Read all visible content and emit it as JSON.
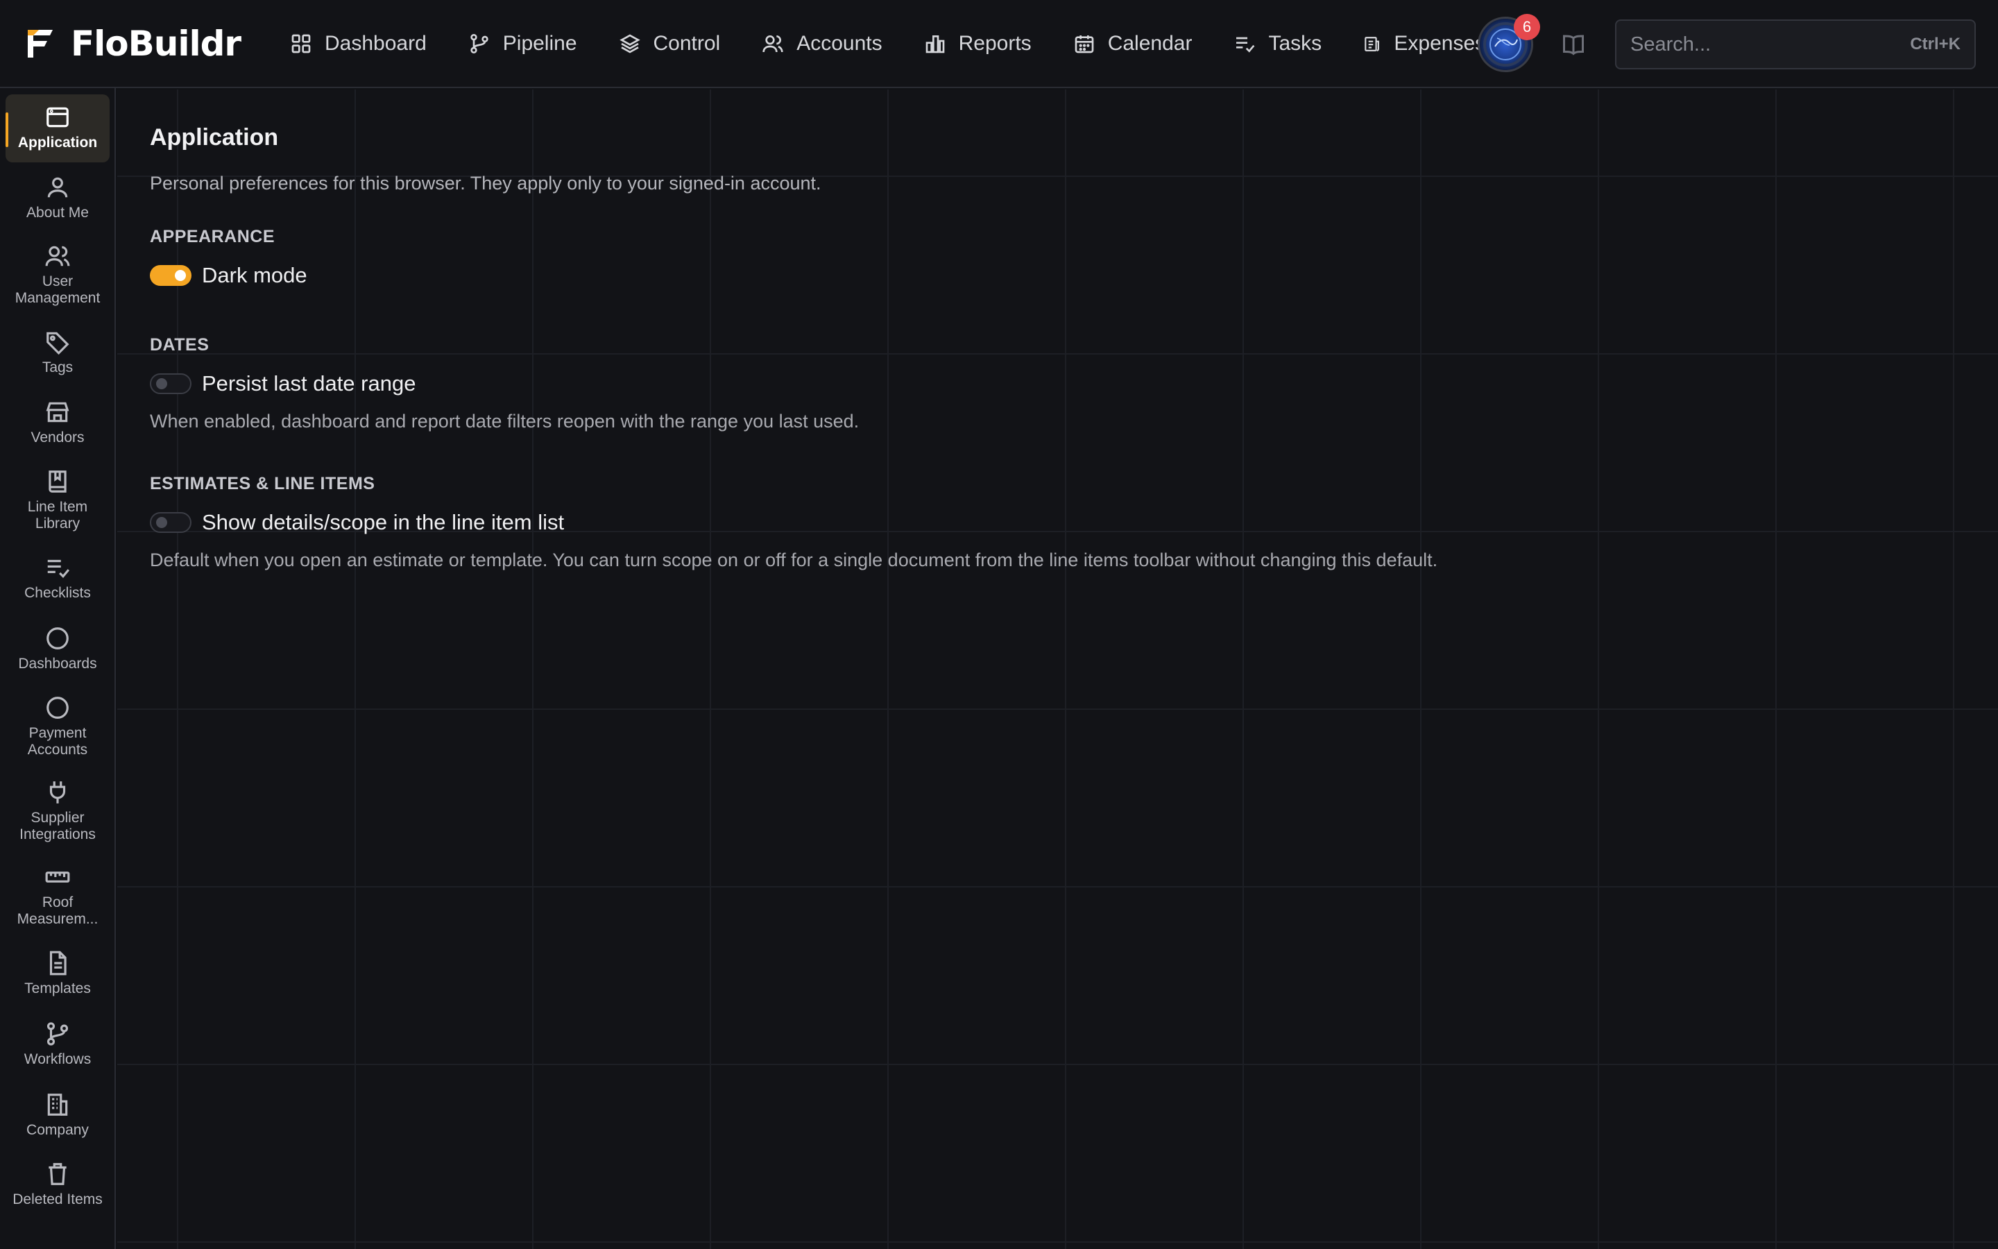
{
  "brand": {
    "name": "FloBuildr"
  },
  "nav": [
    {
      "label": "Dashboard",
      "icon": "grid-icon"
    },
    {
      "label": "Pipeline",
      "icon": "git-branch-icon"
    },
    {
      "label": "Control",
      "icon": "layers-icon"
    },
    {
      "label": "Accounts",
      "icon": "users-icon"
    },
    {
      "label": "Reports",
      "icon": "bar-chart-icon"
    },
    {
      "label": "Calendar",
      "icon": "calendar-icon"
    },
    {
      "label": "Tasks",
      "icon": "checklist-icon"
    },
    {
      "label": "Expenses",
      "icon": "receipt-icon"
    }
  ],
  "notifications": {
    "count": "6"
  },
  "search": {
    "placeholder": "Search...",
    "shortcut": "Ctrl+K"
  },
  "sidebar": {
    "items": [
      {
        "label": "Application",
        "icon": "window-icon",
        "active": true
      },
      {
        "label": "About Me",
        "icon": "user-icon"
      },
      {
        "label": "User Management",
        "icon": "users-icon"
      },
      {
        "label": "Tags",
        "icon": "tag-icon"
      },
      {
        "label": "Vendors",
        "icon": "store-icon"
      },
      {
        "label": "Line Item Library",
        "icon": "book-icon"
      },
      {
        "label": "Checklists",
        "icon": "checklist-icon"
      },
      {
        "label": "Dashboards",
        "icon": "circle-icon"
      },
      {
        "label": "Payment Accounts",
        "icon": "circle-icon"
      },
      {
        "label": "Supplier Integrations",
        "icon": "plug-icon"
      },
      {
        "label": "Roof Measurem...",
        "icon": "ruler-icon"
      },
      {
        "label": "Templates",
        "icon": "file-icon"
      },
      {
        "label": "Workflows",
        "icon": "git-branch-icon"
      },
      {
        "label": "Company",
        "icon": "building-icon"
      },
      {
        "label": "Deleted Items",
        "icon": "trash-icon"
      }
    ]
  },
  "page": {
    "title": "Application",
    "description": "Personal preferences for this browser. They apply only to your signed-in account.",
    "sections": [
      {
        "label": "APPEARANCE",
        "toggle_label": "Dark mode",
        "enabled": true,
        "help": ""
      },
      {
        "label": "DATES",
        "toggle_label": "Persist last date range",
        "enabled": false,
        "help": "When enabled, dashboard and report date filters reopen with the range you last used."
      },
      {
        "label": "ESTIMATES & LINE ITEMS",
        "toggle_label": "Show details/scope in the line item list",
        "enabled": false,
        "help": "Default when you open an estimate or template. You can turn scope on or off for a single document from the line items toolbar without changing this default."
      }
    ]
  },
  "colors": {
    "accent": "#f5a623",
    "badge": "#e5484d",
    "background": "#121317"
  }
}
